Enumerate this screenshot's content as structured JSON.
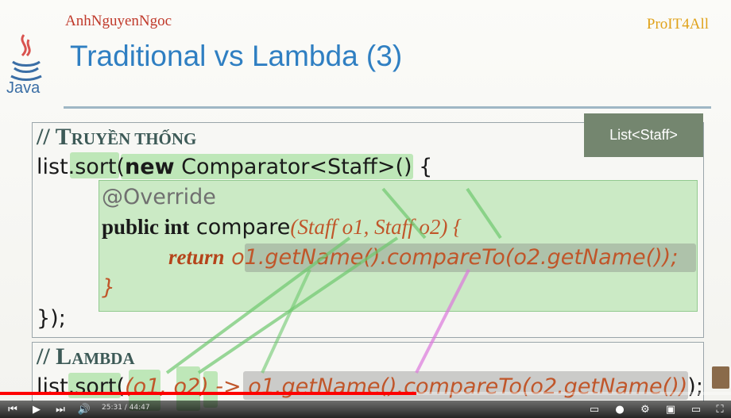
{
  "slide": {
    "author": "AnhNguyenNgoc",
    "brand": "ProIT4All",
    "java_label": "Java",
    "title": "Traditional vs Lambda (3)",
    "badge": "List<Staff>",
    "section1": {
      "slashes": "// ",
      "first": "T",
      "rest": "RUYỀN THỐNG"
    },
    "code1": {
      "line1_a": "list.sort(",
      "line1_kw": "new",
      "line1_b": " Comparator<Staff>() {",
      "line2": "@Override",
      "line3_kw": "public int",
      "line3_b": " compare",
      "line3_params": "(Staff o1, Staff o2) {",
      "line4_kw": "return",
      "line4_expr": " o1.getName().compareTo(o2.getName());",
      "line5": "}",
      "line6": "});"
    },
    "section2": {
      "slashes": "// ",
      "first": "L",
      "rest": "AMBDA"
    },
    "code2": {
      "a": "list.sort(",
      "params": "(o1, o2) ->",
      "expr": " o1.getName().compareTo(o2.getName())",
      "end": ");"
    }
  },
  "player": {
    "current_time": "25:31",
    "duration": "44:47",
    "time_text": "25:31 / 44:47",
    "progress": 0.57,
    "accent": "#ff0000"
  }
}
